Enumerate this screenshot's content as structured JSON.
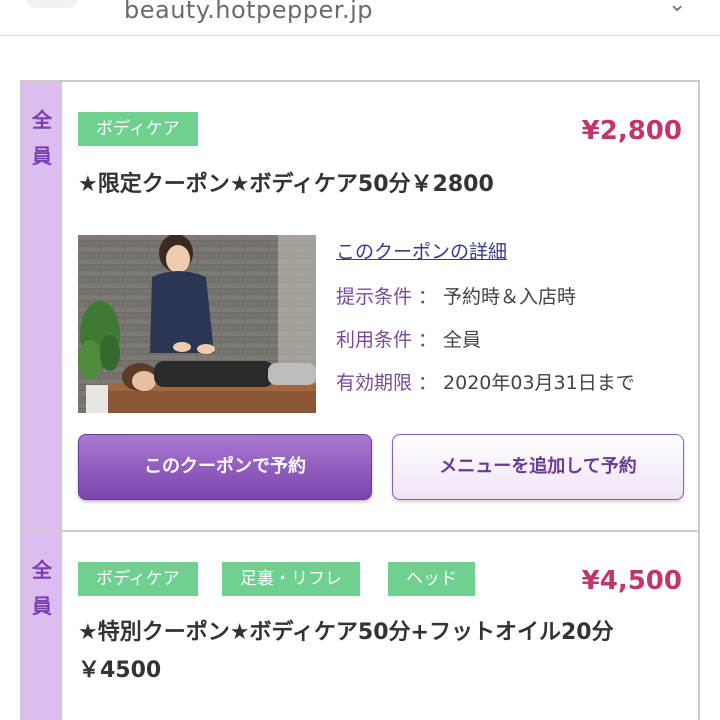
{
  "browser": {
    "url": "beauty.hotpepper.jp"
  },
  "coupons": [
    {
      "target": [
        "全",
        "員"
      ],
      "tags": [
        "ボディケア"
      ],
      "price": "¥2,800",
      "title": "★限定クーポン★ボディケア50分￥2800",
      "detail_link": "このクーポンの詳細",
      "conditions": [
        {
          "label": "提示条件",
          "value": "予約時＆入店時"
        },
        {
          "label": "利用条件",
          "value": "全員"
        },
        {
          "label": "有効期限",
          "value": "2020年03月31日まで"
        }
      ],
      "colon": "：",
      "buttons": {
        "reserve": "このクーポンで予約",
        "add_menu": "メニューを追加して予約"
      }
    },
    {
      "target": [
        "全",
        "員"
      ],
      "tags": [
        "ボディケア",
        "足裏・リフレ",
        "ヘッド"
      ],
      "price": "¥4,500",
      "title": "★特別クーポン★ボディケア50分+フットオイル20分￥4500"
    }
  ],
  "colors": {
    "target_strip": "#dcbdf0",
    "tag": "#6fd08f",
    "price": "#c3336d",
    "primary_button": "#7b44ad"
  }
}
